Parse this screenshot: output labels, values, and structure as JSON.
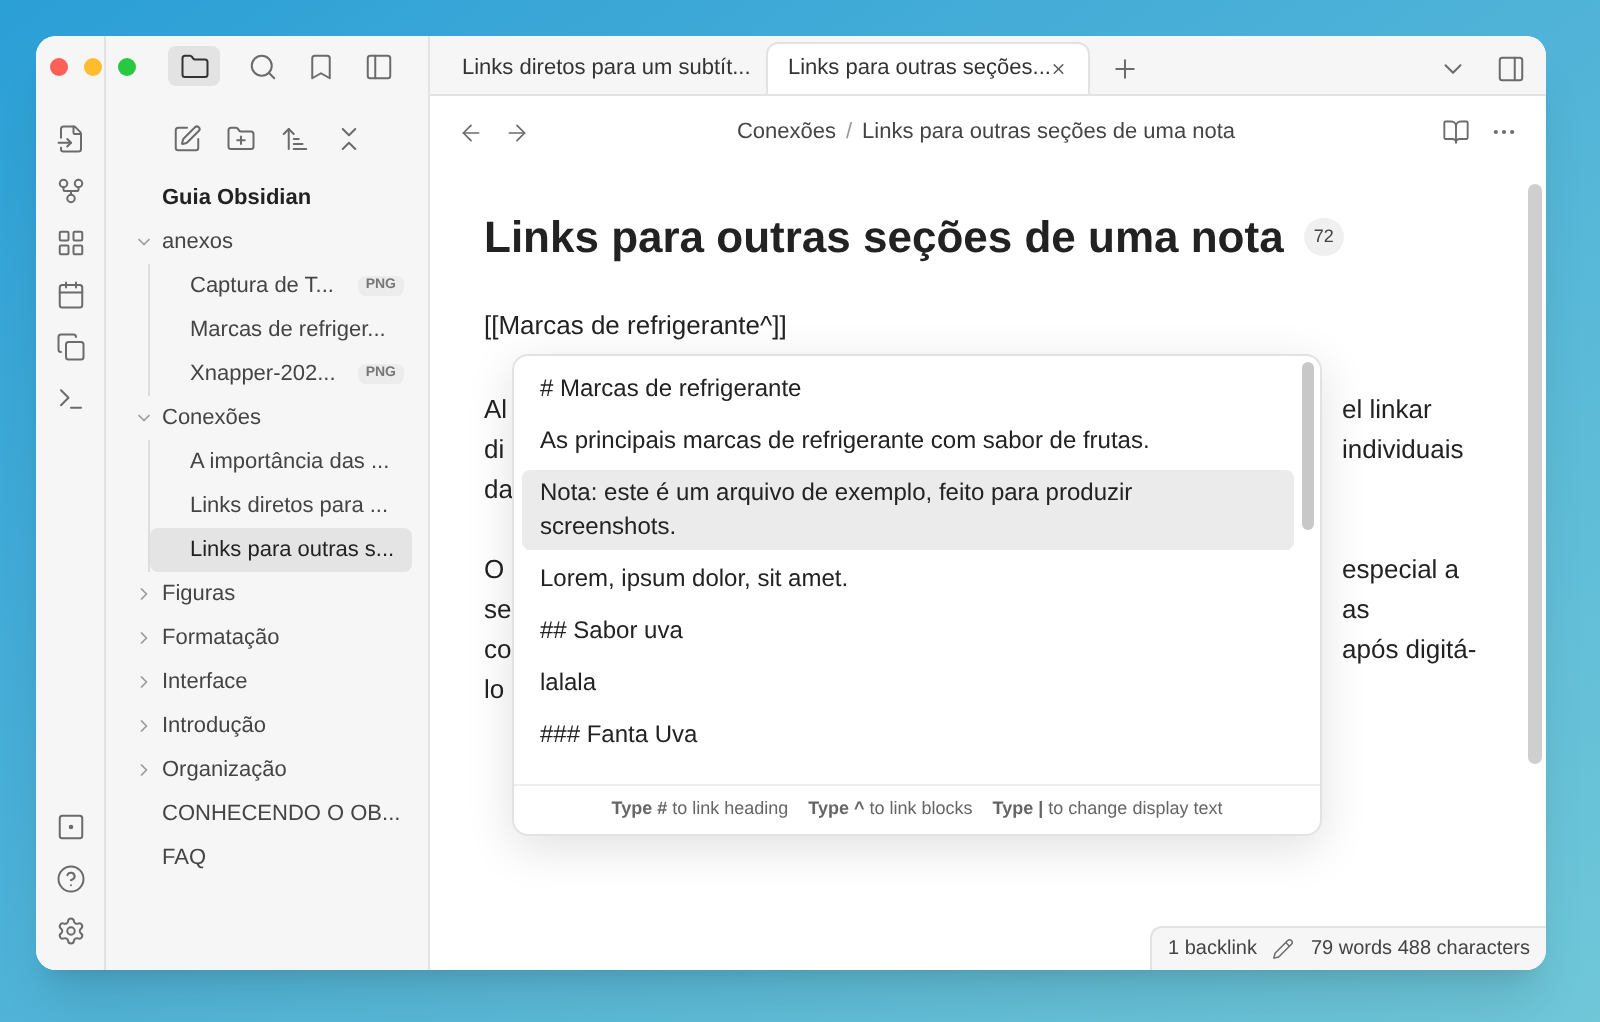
{
  "tabs": [
    {
      "label": "Links diretos para um subtít...",
      "selected": false
    },
    {
      "label": "Links para outras seções...",
      "selected": true
    }
  ],
  "breadcrumb": {
    "parent": "Conexões",
    "separator": "/",
    "current": "Links para outras seções de uma nota"
  },
  "sidebar": {
    "vault": "Guia Obsidian",
    "items": [
      {
        "label": "anexos",
        "kind": "folder",
        "expanded": true,
        "selected": false,
        "children": [
          {
            "label": "Captura de T...",
            "kind": "file",
            "badge": "PNG",
            "selected": false
          },
          {
            "label": "Marcas de refriger...",
            "kind": "file",
            "selected": false
          },
          {
            "label": "Xnapper-202...",
            "kind": "file",
            "badge": "PNG",
            "selected": false
          }
        ]
      },
      {
        "label": "Conexões",
        "kind": "folder",
        "expanded": true,
        "selected": false,
        "children": [
          {
            "label": "A importância das ...",
            "kind": "file",
            "selected": false
          },
          {
            "label": "Links diretos para ...",
            "kind": "file",
            "selected": false
          },
          {
            "label": "Links para outras s...",
            "kind": "file",
            "selected": true
          }
        ]
      },
      {
        "label": "Figuras",
        "kind": "folder",
        "expanded": false,
        "selected": false
      },
      {
        "label": "Formatação",
        "kind": "folder",
        "expanded": false,
        "selected": false
      },
      {
        "label": "Interface",
        "kind": "folder",
        "expanded": false,
        "selected": false
      },
      {
        "label": "Introdução",
        "kind": "folder",
        "expanded": false,
        "selected": false
      },
      {
        "label": "Organização",
        "kind": "folder",
        "expanded": false,
        "selected": false
      },
      {
        "label": "CONHECENDO O OB...",
        "kind": "file",
        "selected": false
      },
      {
        "label": "FAQ",
        "kind": "file",
        "selected": false
      }
    ]
  },
  "note": {
    "title": "Links para outras seções de uma nota",
    "count": "72",
    "link_line": "[[Marcas de refrigerante^]]",
    "paragraphs": [
      [
        {
          "left": "Al",
          "right": "el linkar"
        },
        {
          "left": "di",
          "right": "individuais"
        },
        {
          "left": "da"
        }
      ],
      [
        {
          "left": "O",
          "right": "especial a"
        },
        {
          "left": "se",
          "right": "as"
        },
        {
          "left": "co",
          "right": "após digitá-"
        },
        {
          "left": "lo"
        }
      ]
    ]
  },
  "suggestions": {
    "items": [
      {
        "text": "# Marcas de refrigerante",
        "selected": false
      },
      {
        "text": "As principais marcas de refrigerante com sabor de frutas.",
        "selected": false
      },
      {
        "text": "Nota: este é um arquivo de exemplo, feito para produzir screenshots.",
        "selected": true
      },
      {
        "text": "Lorem, ipsum dolor, sit amet.",
        "selected": false
      },
      {
        "text": "## Sabor uva",
        "selected": false
      },
      {
        "text": "lalala",
        "selected": false
      },
      {
        "text": "### Fanta Uva",
        "selected": false
      }
    ],
    "hints": [
      "**Type #** to link heading",
      "**Type ^** to link blocks",
      "**Type |** to change display text"
    ]
  },
  "status_bar": {
    "backlinks": "1 backlink",
    "counts": "79 words 488 characters"
  }
}
